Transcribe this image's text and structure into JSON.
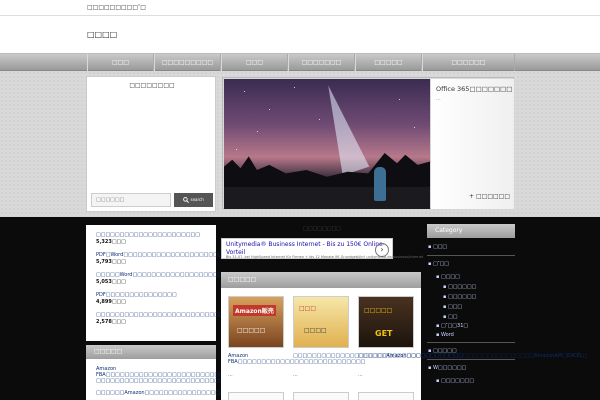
{
  "topbar": {
    "tagline": "□□□□□□□□□″□"
  },
  "header": {
    "logo": "□□□□"
  },
  "nav": {
    "items": [
      {
        "label": "□□□"
      },
      {
        "label": "□□□□□□□□□"
      },
      {
        "label": "□□□"
      },
      {
        "label": "□□□□□□□"
      },
      {
        "label": "□□□□□"
      },
      {
        "label": "□□□□□□"
      }
    ]
  },
  "search": {
    "title": "□□□□□□□□",
    "placeholder": "□□□□□□",
    "button": "search"
  },
  "slider": {
    "title": "Office 365□□□□□□□□□□",
    "subtitle": "...",
    "more": "+ □□□□□□"
  },
  "ranking": {
    "items": [
      {
        "title": "□□□□□□□□□□□□□□□□□□□□□□",
        "count": "5,323□□□"
      },
      {
        "title": "PDF□Word□□□□□□□□□□□□□□□□□□□□□",
        "count": "5,793□□□"
      },
      {
        "title": "□□□□□Word□□□□□□□□□□□□□□□□□□□□□□□□□□□",
        "count": "5,053□□□"
      },
      {
        "title": "PDF□□□□□□□□□□□□□□□",
        "count": "4,899□□□"
      },
      {
        "title": "□□□□□□□□□□□□□□□□□□□□□□□□□□□□□□",
        "count": "2,578□□□"
      }
    ]
  },
  "popular": {
    "heading": "□□□□□",
    "items": [
      {
        "title": "Amazon FBA□□□□□□□□□□□□□□□□□□□□□□□□□□□"
      },
      {
        "title": "□□□□□□□□□□□□□□□□□□□□□□□□□□□□□□□□□□□□"
      },
      {
        "title": "□□□□□□Amazon□□□□□□□□□□□□□□□□□□□□□□□□□□"
      }
    ]
  },
  "ad": {
    "label": "□□□□□□□□",
    "line1": "Unitymedia® Business Internet - Bis zu 150€ Online-",
    "line2": "Vorteil",
    "line3": "Bis 31.07. bei HighSpeed Internet für Firmen + bis 12 Monate 0€ Grundgebühr! unitymedia.de/business/internet"
  },
  "new_posts": {
    "heading": "□□□□□",
    "cards": [
      {
        "thumb_top": "Amazon販売",
        "thumb_bottom": "□□□□□",
        "title": "Amazon FBA□□□□□□□□□□□□□□□□□□□□□□□□□□□",
        "excerpt": "..."
      },
      {
        "thumb_top": "□□□",
        "thumb_bottom": "□□□□",
        "title": "□□□□□□□□□□□□□□□□□□□□□□□□□□□□□□□□□□□□",
        "excerpt": "..."
      },
      {
        "thumb_top": "□□□□□",
        "thumb_bottom": "GET",
        "title": "□□□□□□Amazon□□□□□□□□□□□□□□□□□□□□□□□□□□□AmazonAPI□EXCEL□",
        "excerpt": "..."
      }
    ]
  },
  "category": {
    "heading": "Category",
    "items": [
      {
        "label": "□□□",
        "level": 0
      },
      {
        "label": "□″□□",
        "level": 0
      },
      {
        "label": "□□□□",
        "level": 1
      },
      {
        "label": "□□□□□□",
        "level": 2
      },
      {
        "label": "□□□□□□",
        "level": 2
      },
      {
        "label": "□□□",
        "level": 2
      },
      {
        "label": "□□",
        "level": 2
      },
      {
        "label": "□″□□31□",
        "level": 1
      },
      {
        "label": "Word",
        "level": 1
      },
      {
        "label": "□□□□□",
        "level": 0
      },
      {
        "label": "W□□□□□□",
        "level": 0
      },
      {
        "label": "□□□□□□□",
        "level": 1
      }
    ]
  },
  "colors": {
    "link": "#0a2e6e",
    "nav_bg": "#a8a8a8",
    "dark_bg": "#0b0b0b"
  }
}
